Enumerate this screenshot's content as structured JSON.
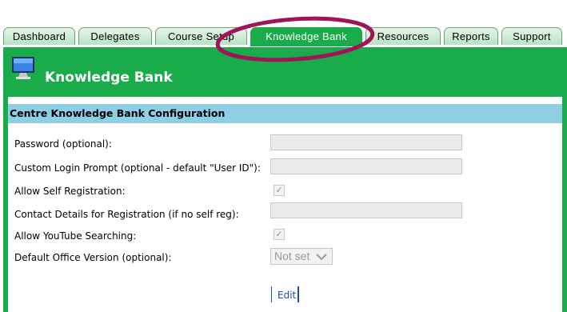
{
  "tabs": [
    {
      "label": "Dashboard"
    },
    {
      "label": "Delegates"
    },
    {
      "label": "Course Setup"
    },
    {
      "label": "Knowledge Bank",
      "active": true
    },
    {
      "label": "Resources"
    },
    {
      "label": "Reports"
    },
    {
      "label": "Support"
    }
  ],
  "header": {
    "title": "Knowledge Bank",
    "icon": "monitor-icon"
  },
  "section": {
    "title": "Centre Knowledge Bank Configuration"
  },
  "form": {
    "password_label": "Password (optional):",
    "login_prompt_label": "Custom Login Prompt (optional - default \"User ID\"):",
    "self_registration_label": "Allow Self Registration:",
    "self_registration_checked": true,
    "contact_details_label": "Contact Details for Registration (if no self reg):",
    "youtube_label": "Allow YouTube Searching:",
    "youtube_checked": true,
    "office_version_label": "Default Office Version (optional):",
    "office_version_value": "Not set",
    "edit_label": "Edit"
  },
  "colors": {
    "accent": "#1aab4b",
    "section_bg": "#8ecfe5",
    "link": "#1f4aa8",
    "annotation": "#a0145a"
  }
}
